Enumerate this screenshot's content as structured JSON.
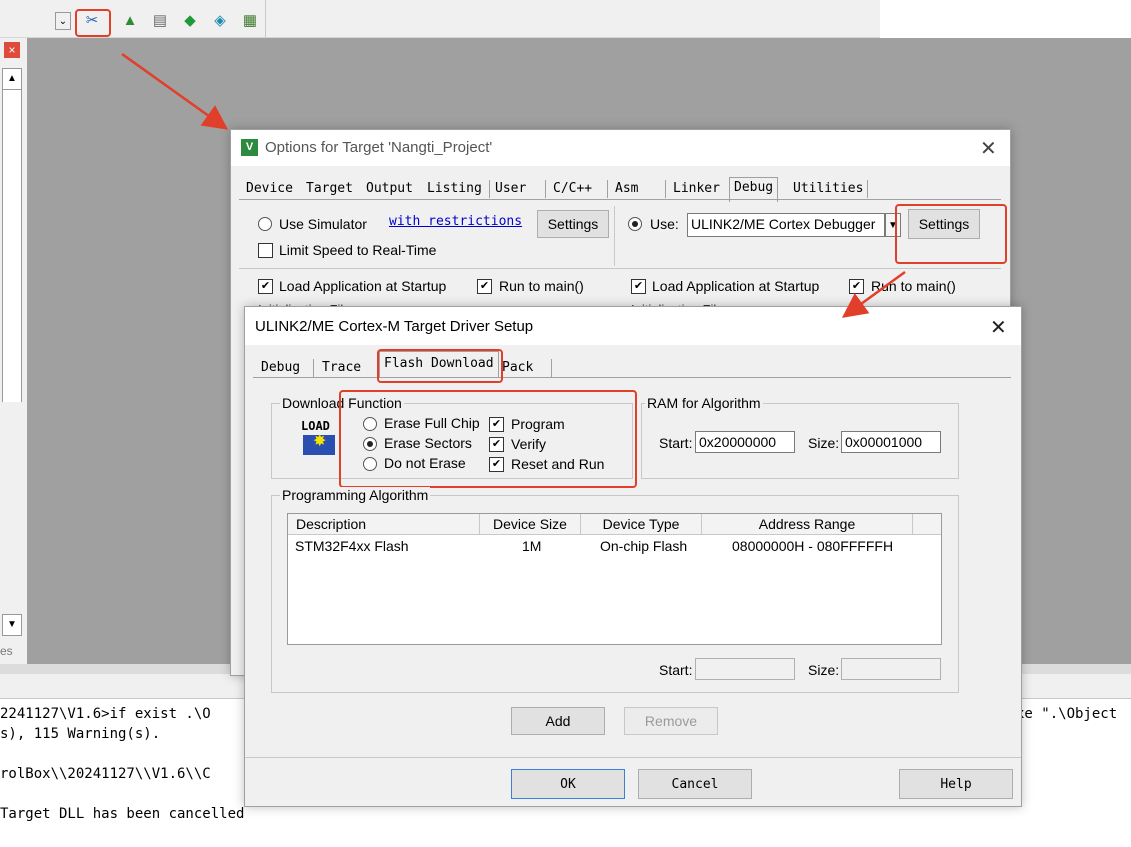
{
  "toolbar": {
    "icons": [
      "dropdown-icon",
      "options-for-target-icon",
      "manage-components-icon",
      "manage-project-items-icon",
      "select-packs-icon",
      "pack-installer-icon",
      "manage-run-time-icon"
    ]
  },
  "output": {
    "lines": [
      "2241127\\V1.6>if exist .\\O",
      "s), 115 Warning(s).",
      "rolBox\\\\20241127\\\\V1.6\\\\C",
      "Target DLL has been cancelled"
    ],
    "right_fragment": "xe \".\\Object",
    "left_fragment": "es"
  },
  "options_dialog": {
    "title": "Options for Target 'Nangti_Project'",
    "tabs": [
      "Device",
      "Target",
      "Output",
      "Listing",
      "User",
      "C/C++",
      "Asm",
      "Linker",
      "Debug",
      "Utilities"
    ],
    "active_tab": "Debug",
    "use_simulator_label": "Use Simulator",
    "with_restrictions_link": "with restrictions",
    "settings_label": "Settings",
    "limit_speed_label": "Limit Speed to Real-Time",
    "use_label": "Use:",
    "debugger_value": "ULINK2/ME Cortex Debugger",
    "load_app_label": "Load Application at Startup",
    "run_to_main_label": "Run to main()",
    "init_file_label": "Initialization File:"
  },
  "setup_dialog": {
    "title": "ULINK2/ME Cortex-M Target Driver Setup",
    "tabs": [
      "Debug",
      "Trace",
      "Flash Download",
      "Pack"
    ],
    "active_tab": "Flash Download",
    "download_function_label": "Download Function",
    "load_icon_text": "LOAD",
    "erase_options": [
      "Erase Full Chip",
      "Erase Sectors",
      "Do not Erase"
    ],
    "erase_selected": "Erase Sectors",
    "checks": [
      "Program",
      "Verify",
      "Reset and Run"
    ],
    "ram_label": "RAM for Algorithm",
    "start_label": "Start:",
    "size_label": "Size:",
    "ram_start": "0x20000000",
    "ram_size": "0x00001000",
    "prog_algo_label": "Programming Algorithm",
    "table_headers": [
      "Description",
      "Device Size",
      "Device Type",
      "Address Range"
    ],
    "table_rows": [
      {
        "description": "STM32F4xx Flash",
        "size": "1M",
        "type": "On-chip Flash",
        "range": "08000000H - 080FFFFFH"
      }
    ],
    "add_label": "Add",
    "remove_label": "Remove",
    "ok_label": "OK",
    "cancel_label": "Cancel",
    "help_label": "Help"
  },
  "colors": {
    "annotation_red": "#e0402a",
    "link_blue": "#0000cc"
  }
}
